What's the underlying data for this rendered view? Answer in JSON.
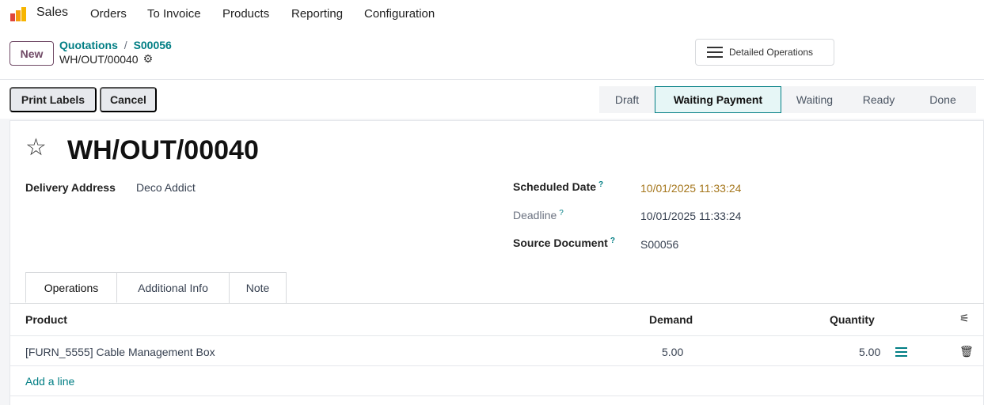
{
  "navbar": {
    "app_name": "Sales",
    "menu": [
      "Orders",
      "To Invoice",
      "Products",
      "Reporting",
      "Configuration"
    ]
  },
  "control_panel": {
    "new_label": "New",
    "breadcrumb": [
      "Quotations",
      "S00056"
    ],
    "breadcrumb_separator": "/",
    "record_name": "WH/OUT/00040",
    "gear_icon": "gear-icon",
    "detailed_operations_label": "Detailed Operations"
  },
  "actions": {
    "print_labels": "Print Labels",
    "cancel": "Cancel"
  },
  "status": {
    "stages": [
      "Draft",
      "Waiting Payment",
      "Waiting",
      "Ready",
      "Done"
    ],
    "current": "Waiting Payment"
  },
  "form": {
    "star_icon": "☆",
    "title": "WH/OUT/00040",
    "delivery_address_label": "Delivery Address",
    "delivery_address_value": "Deco Addict",
    "scheduled_date_label": "Scheduled Date",
    "scheduled_date_value": "10/01/2025 11:33:24",
    "deadline_label": "Deadline",
    "deadline_value": "10/01/2025 11:33:24",
    "source_document_label": "Source Document",
    "source_document_value": "S00056",
    "help_mark": "?"
  },
  "tabs": [
    "Operations",
    "Additional Info",
    "Note"
  ],
  "table": {
    "headers": {
      "product": "Product",
      "demand": "Demand",
      "quantity": "Quantity"
    },
    "rows": [
      {
        "product": "[FURN_5555] Cable Management Box",
        "demand": "5.00",
        "quantity": "5.00"
      }
    ],
    "add_line": "Add a line"
  },
  "colors": {
    "brand": "#714b67",
    "accent": "#017e84",
    "warning": "#a5761c"
  }
}
